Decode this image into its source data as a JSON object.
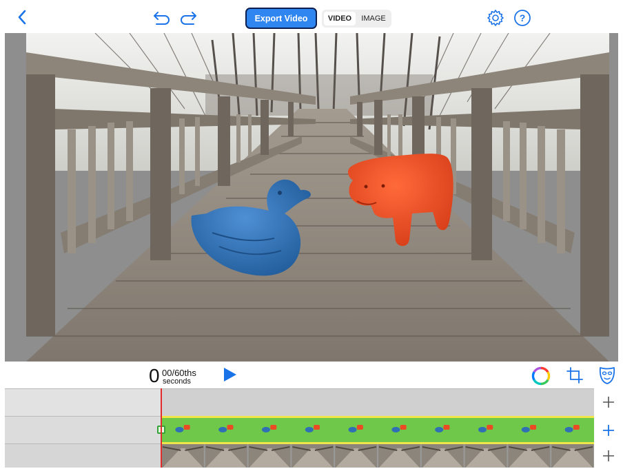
{
  "toolbar": {
    "export_label": "Export Video",
    "mode_options": [
      "VIDEO",
      "IMAGE"
    ],
    "selected_mode": "VIDEO"
  },
  "transport": {
    "time_whole": "0",
    "time_fraction": "00/60ths",
    "time_unit": "seconds"
  },
  "timeline": {
    "tracks": 3,
    "clip_thumbnails": 10,
    "colors": {
      "playhead": "#e32b2b",
      "clip": "#6fc84a",
      "clip_border": "#f0e64a"
    }
  },
  "colors": {
    "accent": "#1a73e8",
    "export_bg": "#2f86f0",
    "duck": "#2f6fb4",
    "horse": "#ea4b24"
  }
}
